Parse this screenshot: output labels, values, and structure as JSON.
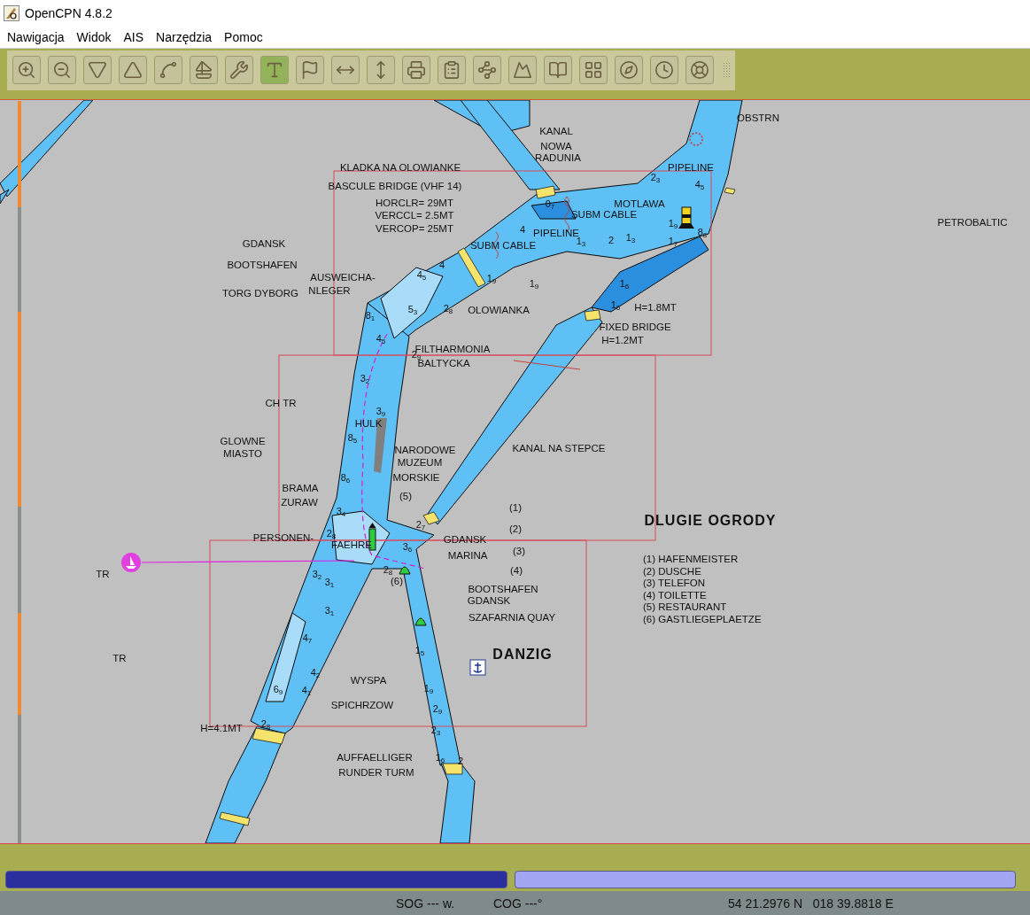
{
  "window": {
    "title": "OpenCPN 4.8.2"
  },
  "menu": [
    "Nawigacja",
    "Widok",
    "AIS",
    "Narzędzia",
    "Pomoc"
  ],
  "toolbar": [
    {
      "kind": "zoom-in",
      "selected": false
    },
    {
      "kind": "zoom-out",
      "selected": false
    },
    {
      "kind": "scale-down",
      "selected": false
    },
    {
      "kind": "scale-up",
      "selected": false
    },
    {
      "kind": "route",
      "selected": false
    },
    {
      "kind": "boat",
      "selected": false
    },
    {
      "kind": "settings",
      "selected": false
    },
    {
      "kind": "text",
      "selected": true
    },
    {
      "kind": "flags",
      "selected": false
    },
    {
      "kind": "horizontal",
      "selected": false
    },
    {
      "kind": "vertical",
      "selected": false
    },
    {
      "kind": "print",
      "selected": false
    },
    {
      "kind": "list",
      "selected": false
    },
    {
      "kind": "track",
      "selected": false
    },
    {
      "kind": "tide",
      "selected": false
    },
    {
      "kind": "help",
      "selected": false
    },
    {
      "kind": "dashboard",
      "selected": false
    },
    {
      "kind": "compass",
      "selected": false
    },
    {
      "kind": "clock",
      "selected": false
    },
    {
      "kind": "lifebuoy",
      "selected": false
    }
  ],
  "chart_labels": [
    {
      "kind": "feature",
      "text": "KANAL"
    },
    {
      "kind": "feature",
      "text": "NOWA"
    },
    {
      "kind": "feature",
      "text": "RADUNIA"
    },
    {
      "kind": "feature",
      "text": "KLADKA NA OLOWIANKE"
    },
    {
      "kind": "feature",
      "text": "BASCULE BRIDGE (VHF 14)"
    },
    {
      "kind": "feature",
      "text": "HORCLR= 29MT"
    },
    {
      "kind": "feature",
      "text": "VERCCL= 2.5MT"
    },
    {
      "kind": "feature",
      "text": "VERCOP= 25MT"
    },
    {
      "kind": "feature",
      "text": "GDANSK"
    },
    {
      "kind": "feature",
      "text": "BOOTSHAFEN"
    },
    {
      "kind": "feature",
      "text": "TORG DYBORG"
    },
    {
      "kind": "feature",
      "text": "AUSWEICHA-"
    },
    {
      "kind": "feature",
      "text": "NLEGER"
    },
    {
      "kind": "feature",
      "text": "MOTLAWA"
    },
    {
      "kind": "feature",
      "text": "SUBM CABLE"
    },
    {
      "kind": "feature",
      "text": "PIPELINE"
    },
    {
      "kind": "feature",
      "text": "SUBM CABLE"
    },
    {
      "kind": "feature",
      "text": "OLOWIANKA"
    },
    {
      "kind": "feature",
      "text": "H=1.8MT"
    },
    {
      "kind": "feature",
      "text": "FIXED BRIDGE"
    },
    {
      "kind": "feature",
      "text": "H=1.2MT"
    },
    {
      "kind": "feature",
      "text": "FILTHARMONIA"
    },
    {
      "kind": "feature",
      "text": "BALTYCKA"
    },
    {
      "kind": "feature",
      "text": "PIPELINE"
    },
    {
      "kind": "feature",
      "text": "OBSTRN"
    },
    {
      "kind": "feature",
      "text": "PETROBALTIC"
    },
    {
      "kind": "feature",
      "text": "CH TR"
    },
    {
      "kind": "feature",
      "text": "HULK"
    },
    {
      "kind": "feature",
      "text": "GLOWNE"
    },
    {
      "kind": "feature",
      "text": "MIASTO"
    },
    {
      "kind": "feature",
      "text": "NARODOWE"
    },
    {
      "kind": "feature",
      "text": "MUZEUM"
    },
    {
      "kind": "feature",
      "text": "MORSKIE"
    },
    {
      "kind": "feature",
      "text": "(5)"
    },
    {
      "kind": "feature",
      "text": "BRAMA"
    },
    {
      "kind": "feature",
      "text": "ZURAW"
    },
    {
      "kind": "feature",
      "text": "KANAL NA STEPCE"
    },
    {
      "kind": "feature",
      "text": "(1)"
    },
    {
      "kind": "feature",
      "text": "(2)"
    },
    {
      "kind": "feature",
      "text": "(3)"
    },
    {
      "kind": "feature",
      "text": "(4)"
    },
    {
      "kind": "area",
      "text": "DLUGIE OGRODY"
    },
    {
      "kind": "feature",
      "text": "PERSONEN-"
    },
    {
      "kind": "feature",
      "text": "FAEHRE"
    },
    {
      "kind": "feature",
      "text": "GDANSK"
    },
    {
      "kind": "feature",
      "text": "MARINA"
    },
    {
      "kind": "feature",
      "text": "TR"
    },
    {
      "kind": "feature",
      "text": "(6)"
    },
    {
      "kind": "feature",
      "text": "BOOTSHAFEN"
    },
    {
      "kind": "feature",
      "text": "GDANSK"
    },
    {
      "kind": "feature",
      "text": "SZAFARNIA QUAY"
    },
    {
      "kind": "area",
      "text": "DANZIG"
    },
    {
      "kind": "feature",
      "text": "TR"
    },
    {
      "kind": "feature",
      "text": "WYSPA"
    },
    {
      "kind": "feature",
      "text": "SPICHRZOW"
    },
    {
      "kind": "feature",
      "text": "H=4.1MT"
    },
    {
      "kind": "feature",
      "text": "AUFFAELLIGER"
    },
    {
      "kind": "feature",
      "text": "RUNDER TURM"
    }
  ],
  "legend": [
    "(1) HAFENMEISTER",
    "(2) DUSCHE",
    "(3) TELEFON",
    "(4) TOILETTE",
    "(5) RESTAURANT",
    "(6) GASTLIEGEPLAETZE"
  ],
  "soundings": [
    "0$_{7}$",
    "4",
    "4$_{5}$",
    "4",
    "5$_{3}$",
    "8$_{1}$",
    "2$_{8}$",
    "1$_{9}$",
    "1$_{9}$",
    "1$_{3}$",
    "2",
    "1$_{3}$",
    "1$_{9}$",
    "1$_{7}$",
    "8$_{8}$",
    "2$_{3}$",
    "4$_{5}$",
    "1$_{6}$",
    "1$_{6}$",
    "4$_{5}$",
    "2$_{9}$",
    "3$_{2}$",
    "3$_{9}$",
    "8$_{5}$",
    "8$_{6}$",
    "3$_{4}$",
    "2$_{8}$",
    "2$_{7}$",
    "3$_{6}$",
    "3$_{2}$",
    "3$_{1}$",
    "2$_{8}$",
    "3$_{1}$",
    "4$_{7}$",
    "4$_{2}$",
    "4$_{1}$",
    "1$_{5}$",
    "6$_{9}$",
    "1$_{9}$",
    "2$_{9}$",
    "2$_{3}$",
    "2$_{8}$",
    "1$_{6}$",
    "2"
  ],
  "chart_bars": [
    {
      "selected": true
    },
    {
      "selected": false
    }
  ],
  "status_bar": {
    "sog": "SOG --- w.",
    "cog": "COG ---°",
    "position": "54 21.2976 N   018 39.8818 E"
  }
}
